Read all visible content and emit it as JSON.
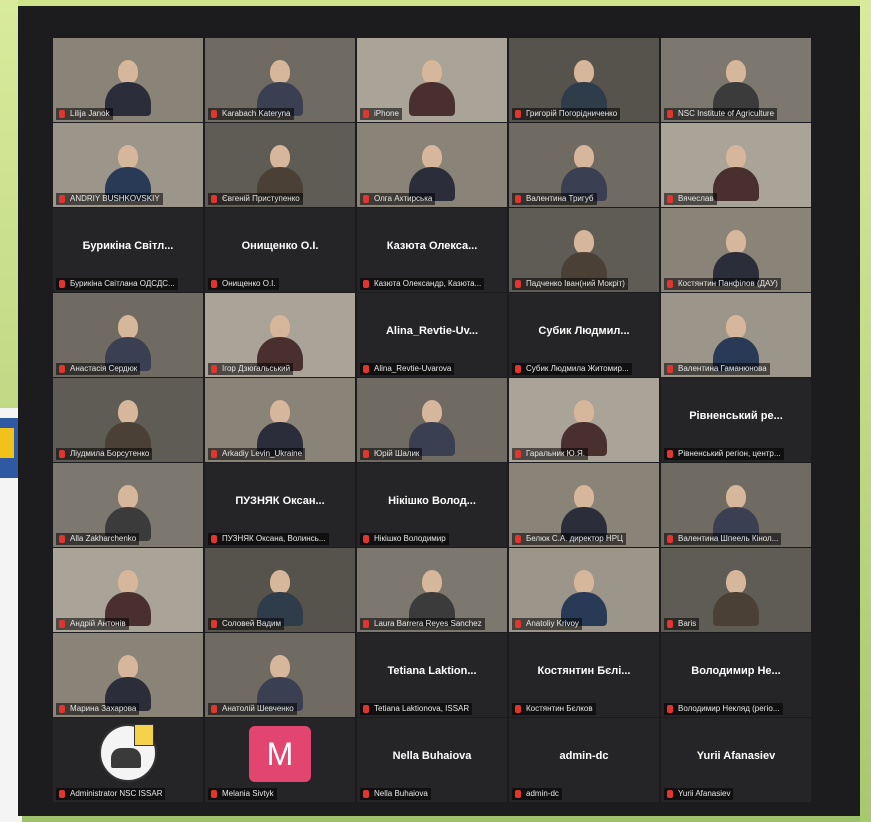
{
  "participants": [
    {
      "name": "Lilija Janok",
      "type": "video"
    },
    {
      "name": "Karabach Kateryna",
      "type": "video"
    },
    {
      "name": "iPhone",
      "type": "video"
    },
    {
      "name": "Григорій Погорідниченко",
      "type": "video"
    },
    {
      "name": "NSC Institute of Agriculture",
      "type": "video"
    },
    {
      "name": "ANDRIY BUSHKOVSKIY",
      "type": "video"
    },
    {
      "name": "Євгеній Приступенко",
      "type": "video"
    },
    {
      "name": "Олга Ахтирська",
      "type": "video"
    },
    {
      "name": "Валентина Тригуб",
      "type": "video"
    },
    {
      "name": "Вячеслав",
      "type": "video"
    },
    {
      "name": "Бурикіна Світлана ОДСДС...",
      "type": "text",
      "display": "Бурикіна Світл..."
    },
    {
      "name": "Онищенко О.І.",
      "type": "text",
      "display": "Онищенко О.І."
    },
    {
      "name": "Казюта Олександр, Казюта...",
      "type": "text",
      "display": "Казюта Олекса..."
    },
    {
      "name": "Падченко Іван(ний Мокріт)",
      "type": "video"
    },
    {
      "name": "Костянтин Панфілов (ДАУ)",
      "type": "video"
    },
    {
      "name": "Анастасія Сердюк",
      "type": "video"
    },
    {
      "name": "Ігор Дзюгальський",
      "type": "video"
    },
    {
      "name": "Alina_Revtie-Uvarova",
      "type": "text",
      "display": "Alina_Revtie-Uv..."
    },
    {
      "name": "Субик Людмила Житомир...",
      "type": "text",
      "display": "Субик Людмил..."
    },
    {
      "name": "Валентина Гаманюнова",
      "type": "video"
    },
    {
      "name": "Ліудмила Борсутенко",
      "type": "video"
    },
    {
      "name": "Arkadiy Levin_Ukraine",
      "type": "video"
    },
    {
      "name": "Юрій Шалик",
      "type": "video"
    },
    {
      "name": "Гаральник Ю.Я.",
      "type": "video"
    },
    {
      "name": "Рівненський регіон, центр...",
      "type": "text",
      "display": "Рівненський ре..."
    },
    {
      "name": "Alla Zakharchenko",
      "type": "video"
    },
    {
      "name": "ПУЗНЯК Оксана, Волинсь...",
      "type": "text",
      "display": "ПУЗНЯК Оксан..."
    },
    {
      "name": "Нікішко Володимир",
      "type": "text",
      "display": "Нікішко Волод..."
    },
    {
      "name": "Белюк С.А. директор НРЦ",
      "type": "video"
    },
    {
      "name": "Валентина Шпеель Кінол...",
      "type": "video"
    },
    {
      "name": "Андрій Антонів",
      "type": "video"
    },
    {
      "name": "Соловей Вадим",
      "type": "video"
    },
    {
      "name": "Laura Barrera Reyes Sanchez",
      "type": "video"
    },
    {
      "name": "Anatoliy Krivoy",
      "type": "video"
    },
    {
      "name": "Baris",
      "type": "video"
    },
    {
      "name": "Марина Захарова",
      "type": "video"
    },
    {
      "name": "Анатолій Шевченко",
      "type": "video"
    },
    {
      "name": "Tetiana Laktionova, ISSAR",
      "type": "text",
      "display": "Tetiana Laktion..."
    },
    {
      "name": "Костянтин Бєлков",
      "type": "text",
      "display": "Костянтин Бєлі..."
    },
    {
      "name": "Володимир Некляд (регіо...",
      "type": "text",
      "display": "Володимир Не..."
    },
    {
      "name": "Administrator NSC ISSAR",
      "type": "logo"
    },
    {
      "name": "Melania Sivtyk",
      "type": "avatar",
      "avatar_letter": "M"
    },
    {
      "name": "Nella Buhaiova",
      "type": "text",
      "display": "Nella Buhaiova"
    },
    {
      "name": "admin-dc",
      "type": "text",
      "display": "admin-dc"
    },
    {
      "name": "Yurii Afanasiev",
      "type": "text",
      "display": "Yurii Afanasiev"
    }
  ],
  "speaking_index": 28,
  "colors": {
    "avatar": "#e2456f",
    "speaking": "#3cbf6a",
    "background": "#1c1c1e"
  }
}
